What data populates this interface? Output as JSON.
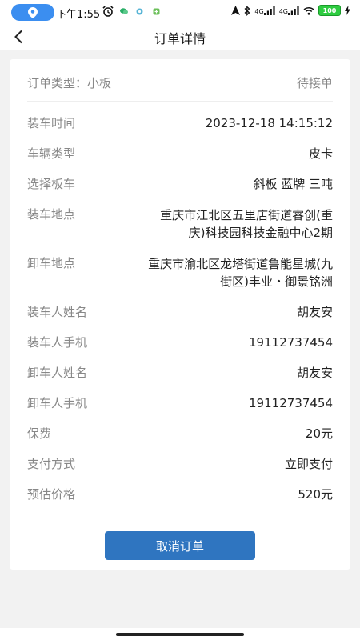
{
  "status_bar": {
    "time": "下午1:55",
    "network_labels": [
      "4G",
      "4G"
    ],
    "battery": "100"
  },
  "nav": {
    "title": "订单详情"
  },
  "order": {
    "type_label": "订单类型：",
    "type_value": "小板",
    "status": "待接单",
    "rows": [
      {
        "label": "装车时间",
        "value": "2023-12-18 14:15:12"
      },
      {
        "label": "车辆类型",
        "value": "皮卡"
      },
      {
        "label": "选择板车",
        "value": "斜板 蓝牌 三吨"
      },
      {
        "label": "装车地点",
        "value_line1": "重庆市江北区五里店街道睿创(重",
        "value_line2": "庆)科技园科技金融中心2期"
      },
      {
        "label": "卸车地点",
        "value_line1": "重庆市渝北区龙塔街道鲁能星城(九",
        "value_line2": "街区)丰业・御景铭洲"
      },
      {
        "label": "装车人姓名",
        "value": "胡友安"
      },
      {
        "label": "装车人手机",
        "value": "19112737454"
      },
      {
        "label": "卸车人姓名",
        "value": "胡友安"
      },
      {
        "label": "卸车人手机",
        "value": "19112737454"
      },
      {
        "label": "保费",
        "value": "20元"
      },
      {
        "label": "支付方式",
        "value": "立即支付"
      },
      {
        "label": "预估价格",
        "value": "520元"
      }
    ]
  },
  "actions": {
    "cancel_label": "取消订单"
  },
  "colors": {
    "primary": "#2f75c0",
    "background": "#f2f2f2",
    "label": "#888888",
    "value": "#222222"
  }
}
